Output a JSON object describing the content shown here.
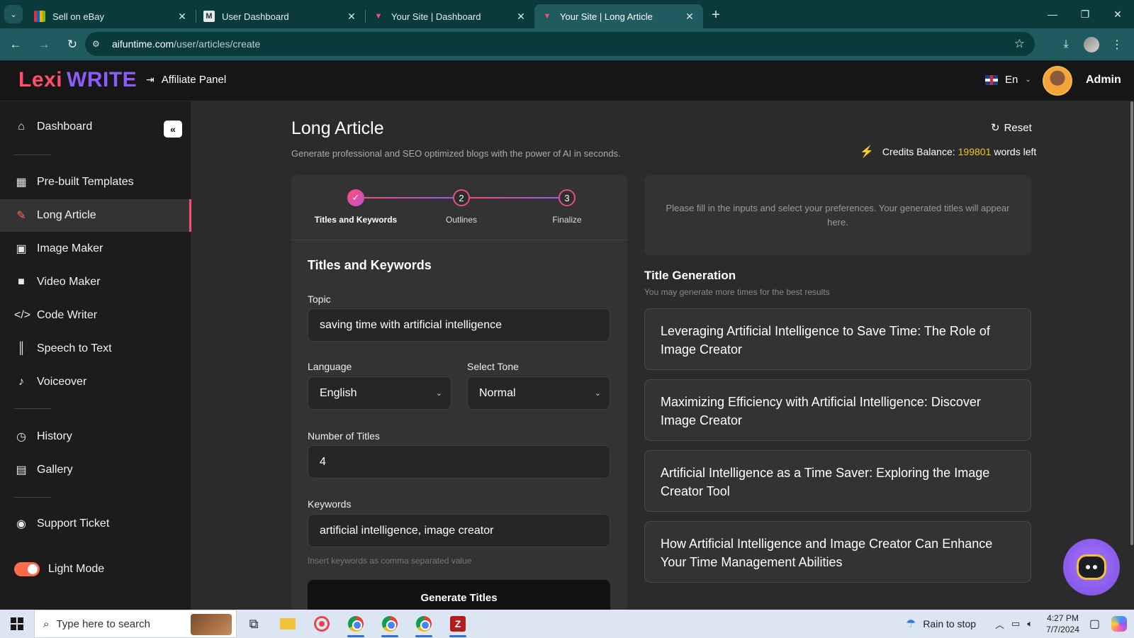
{
  "browser": {
    "tabs": [
      {
        "label": "Sell on eBay",
        "active": false
      },
      {
        "label": "User Dashboard",
        "active": false
      },
      {
        "label": "Your Site | Dashboard",
        "active": false
      },
      {
        "label": "Your Site | Long Article",
        "active": true
      }
    ],
    "url_host": "aifuntime.com",
    "url_path": "/user/articles/create"
  },
  "header": {
    "logo_left": "Lexi",
    "logo_right": "WRITE",
    "affiliate_label": "Affiliate Panel",
    "language": "En",
    "user_name": "Admin"
  },
  "sidebar": {
    "items": [
      {
        "label": "Dashboard",
        "icon": "home-icon"
      },
      {
        "label": "Pre-built Templates",
        "icon": "grid-icon"
      },
      {
        "label": "Long Article",
        "icon": "pen-icon",
        "active": true
      },
      {
        "label": "Image Maker",
        "icon": "image-icon"
      },
      {
        "label": "Video Maker",
        "icon": "video-icon"
      },
      {
        "label": "Code Writer",
        "icon": "code-icon"
      },
      {
        "label": "Speech to Text",
        "icon": "waveform-icon"
      },
      {
        "label": "Voiceover",
        "icon": "microphone-icon"
      },
      {
        "label": "History",
        "icon": "history-icon"
      },
      {
        "label": "Gallery",
        "icon": "gallery-icon"
      },
      {
        "label": "Support Ticket",
        "icon": "support-icon"
      }
    ],
    "light_mode_label": "Light Mode",
    "light_mode_on": true
  },
  "page": {
    "title": "Long Article",
    "subtitle": "Generate professional and SEO optimized blogs with the power of AI in seconds.",
    "reset_label": "Reset",
    "credits_prefix": "Credits Balance:",
    "credits_value": "199801",
    "credits_suffix": "words left"
  },
  "stepper": {
    "steps": [
      {
        "number": "✓",
        "label": "Titles and Keywords",
        "done": true
      },
      {
        "number": "2",
        "label": "Outlines",
        "done": false
      },
      {
        "number": "3",
        "label": "Finalize",
        "done": false
      }
    ]
  },
  "form": {
    "section_title": "Titles and Keywords",
    "topic_label": "Topic",
    "topic_value": "saving time with artificial intelligence",
    "language_label": "Language",
    "language_value": "English",
    "tone_label": "Select Tone",
    "tone_value": "Normal",
    "num_titles_label": "Number of Titles",
    "num_titles_value": "4",
    "keywords_label": "Keywords",
    "keywords_value": "artificial intelligence, image creator",
    "keywords_hint": "Insert keywords as comma separated value",
    "generate_label": "Generate Titles"
  },
  "results": {
    "placeholder": "Please fill in the inputs and select your preferences. Your generated titles will appear here.",
    "section_title": "Title Generation",
    "section_subtitle": "You may generate more times for the best results",
    "titles": [
      "Leveraging Artificial Intelligence to Save Time: The Role of Image Creator",
      "Maximizing Efficiency with Artificial Intelligence: Discover Image Creator",
      "Artificial Intelligence as a Time Saver: Exploring the Image Creator Tool",
      "How Artificial Intelligence and Image Creator Can Enhance Your Time Management Abilities"
    ]
  },
  "taskbar": {
    "search_placeholder": "Type here to search",
    "weather": "Rain to stop",
    "time": "4:27 PM",
    "date": "7/7/2024"
  }
}
